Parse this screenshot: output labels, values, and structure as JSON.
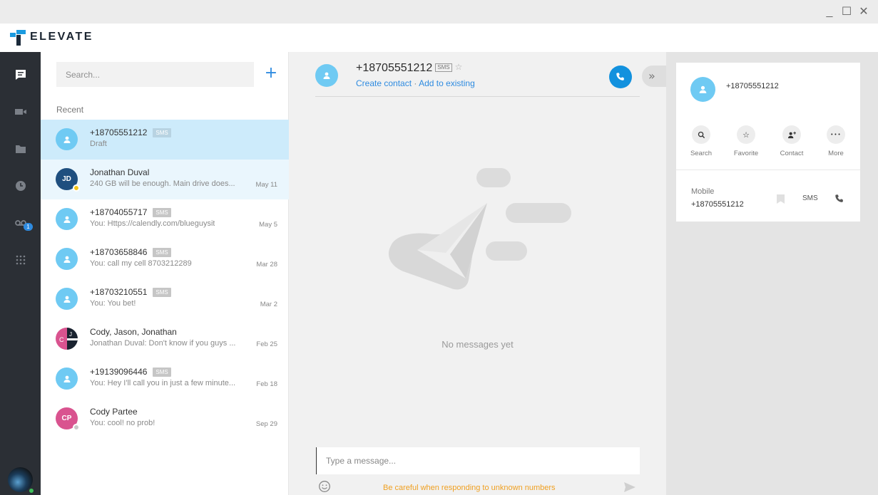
{
  "window": {
    "minimize_glyph": "_",
    "maximize_glyph": "☐",
    "close_glyph": "✕"
  },
  "brand": {
    "name": "ELEVATE",
    "color": "#1b9be0"
  },
  "rail": {
    "items": [
      {
        "icon": "chat-icon",
        "active": true
      },
      {
        "icon": "video-icon"
      },
      {
        "icon": "folder-icon"
      },
      {
        "icon": "clock-icon"
      },
      {
        "icon": "voicemail-icon",
        "badge": "1"
      },
      {
        "icon": "dialpad-icon"
      }
    ],
    "status_color": "#3fbf5a"
  },
  "list": {
    "search_placeholder": "Search...",
    "add_label": "+",
    "recent_label": "Recent",
    "conversations": [
      {
        "title": "+18705551212",
        "sms": "SMS",
        "preview": "Draft",
        "date": "",
        "avatar": "person-icon",
        "selected": true
      },
      {
        "title": "Jonathan Duval",
        "preview": "240 GB will be enough. Main drive does...",
        "date": "May 11",
        "initials": "JD",
        "avatar_color": "#1f4f7f",
        "status_color": "#f5c518"
      },
      {
        "title": "+18704055717",
        "sms": "SMS",
        "preview": "You: Https://calendly.com/blueguysit",
        "date": "May 5",
        "avatar": "person-icon"
      },
      {
        "title": "+18703658846",
        "sms": "SMS",
        "preview": "You: call my cell 8703212289",
        "date": "Mar 28",
        "avatar": "person-icon"
      },
      {
        "title": "+18703210551",
        "sms": "SMS",
        "preview": "You: You bet!",
        "date": "Mar 2",
        "avatar": "person-icon"
      },
      {
        "title": "Cody, Jason, Jonathan",
        "preview": "Jonathan Duval: Don't know if you guys ...",
        "date": "Feb 25",
        "avatar": "group-icon",
        "group_initials": [
          "C",
          "J"
        ]
      },
      {
        "title": "+19139096446",
        "sms": "SMS",
        "preview": "You: Hey I'll call you in just a few minute...",
        "date": "Feb 18",
        "avatar": "person-icon"
      },
      {
        "title": "Cody Partee",
        "preview": "You: cool! no prob!",
        "date": "Sep 29",
        "initials": "CP",
        "avatar_color": "#d9538f",
        "status_color": "#c8c8c8"
      }
    ]
  },
  "chat": {
    "title": "+18705551212",
    "sms_tag": "SMS",
    "star": "☆",
    "create_contact": "Create contact",
    "link_sep": " · ",
    "add_to_existing": "Add to existing",
    "expand_glyph": "»",
    "empty_text": "No messages yet",
    "compose_placeholder": "Type a message...",
    "warning": "Be careful when responding to unknown numbers",
    "accent": "#1291de",
    "warning_color": "#f0a021"
  },
  "side": {
    "name": "+18705551212",
    "actions": [
      {
        "label": "Search",
        "icon": "search-icon",
        "glyph": "⚲"
      },
      {
        "label": "Favorite",
        "icon": "star-icon",
        "glyph": "☆"
      },
      {
        "label": "Contact",
        "icon": "add-contact-icon",
        "glyph": "+"
      },
      {
        "label": "More",
        "icon": "more-icon",
        "glyph": "•••"
      }
    ],
    "mobile_label": "Mobile",
    "mobile_number": "+18705551212",
    "sms_label": "SMS"
  }
}
